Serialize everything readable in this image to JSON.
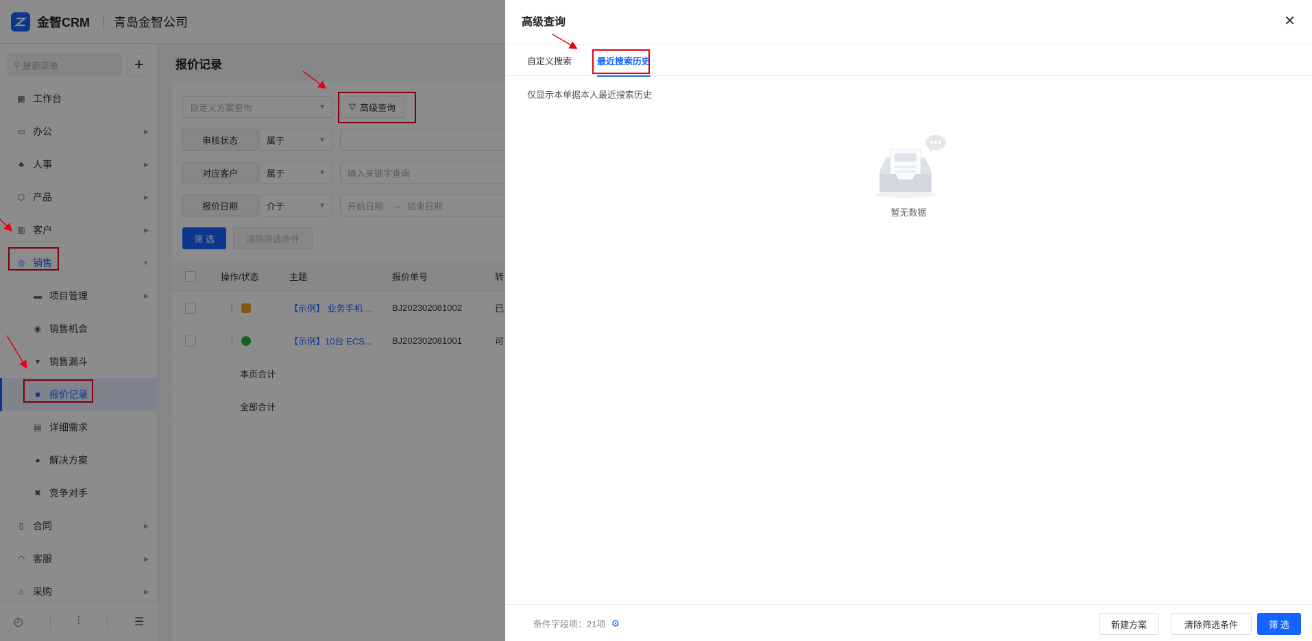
{
  "app": {
    "name": "金智CRM",
    "company": "青岛金智公司"
  },
  "sidebar": {
    "search_placeholder": "搜索菜单",
    "add_label": "+",
    "items": [
      {
        "label": "工作台",
        "icon": "dashboard-icon"
      },
      {
        "label": "办公",
        "icon": "office-icon"
      },
      {
        "label": "人事",
        "icon": "hr-icon"
      },
      {
        "label": "产品",
        "icon": "product-icon"
      },
      {
        "label": "客户",
        "icon": "customer-icon"
      },
      {
        "label": "销售",
        "icon": "sales-icon"
      },
      {
        "label": "项目管理",
        "icon": "folder-icon"
      },
      {
        "label": "销售机会",
        "icon": "opportunity-icon"
      },
      {
        "label": "销售漏斗",
        "icon": "funnel-icon"
      },
      {
        "label": "报价记录",
        "icon": "quote-icon"
      },
      {
        "label": "详细需求",
        "icon": "document-icon"
      },
      {
        "label": "解决方案",
        "icon": "bulb-icon"
      },
      {
        "label": "竞争对手",
        "icon": "competitor-icon"
      },
      {
        "label": "合同",
        "icon": "contract-icon"
      },
      {
        "label": "客服",
        "icon": "headset-icon"
      },
      {
        "label": "采购",
        "icon": "purchase-icon"
      }
    ]
  },
  "page": {
    "title": "报价记录",
    "scheme_placeholder": "自定义方案查询",
    "advanced_button": "高级查询",
    "filters": [
      {
        "label": "审核状态",
        "op": "属于",
        "placeholder": ""
      },
      {
        "label": "对应客户",
        "op": "属于",
        "placeholder": "输入关键字查询"
      },
      {
        "label": "报价日期",
        "op": "介于",
        "start": "开始日期",
        "sep": "→",
        "end": "结束日期"
      }
    ],
    "filter_button": "筛 选",
    "clear_button": "清除筛选条件",
    "table": {
      "headers": [
        "操作/状态",
        "主题",
        "报价单号",
        "转"
      ],
      "rows": [
        {
          "subject": "【示例】 业务手机 ...",
          "number": "BJ202302081002",
          "extra": "已"
        },
        {
          "subject": "【示例】10台 ECS...",
          "number": "BJ202302081001",
          "extra": "可"
        }
      ],
      "page_total": "本页合计",
      "all_total": "全部合计"
    }
  },
  "drawer": {
    "title": "高级查询",
    "tabs": [
      "自定义搜索",
      "最近搜索历史"
    ],
    "hint": "仅显示本单据本人最近搜索历史",
    "empty_text": "暂无数据",
    "footer_info": "条件字段项：21项",
    "buttons": {
      "new_scheme": "新建方案",
      "clear": "清除筛选条件",
      "filter": "筛 选"
    }
  },
  "colors": {
    "accent": "#1664ff",
    "annotation": "#e60012"
  }
}
